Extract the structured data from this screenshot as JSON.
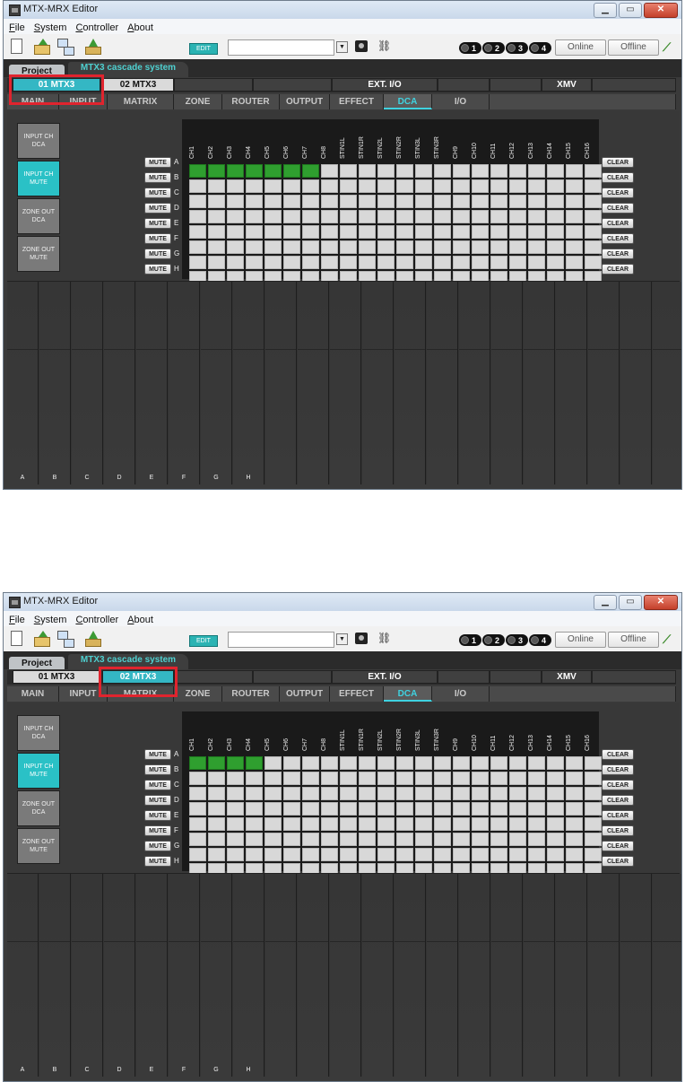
{
  "screenshots": [
    {
      "window": {
        "title": "MTX-MRX Editor",
        "buttons": [
          "▁",
          "▭",
          "✕"
        ]
      },
      "menu": [
        "File",
        "System",
        "Controller",
        "About"
      ],
      "menu_mnemonic": [
        "F",
        "S",
        "C",
        "A"
      ],
      "toolbar": {
        "edit_label": "EDIT",
        "signal_buttons": [
          "1",
          "2",
          "3",
          "4"
        ],
        "online_label": "Online",
        "offline_label": "Offline"
      },
      "tabs": {
        "project": "Project",
        "system": "MTX3 cascade system"
      },
      "units": [
        "01 MTX3",
        "02 MTX3",
        "",
        "",
        "EXT. I/O",
        "",
        "",
        "XMV",
        ""
      ],
      "selected_unit": 0,
      "function_tabs": [
        "MAIN",
        "INPUT",
        "MATRIX",
        "ZONE",
        "ROUTER",
        "OUTPUT",
        "EFFECT",
        "DCA",
        "I/O"
      ],
      "selected_function_tab": 7,
      "side_buttons": [
        "INPUT CH\nDCA",
        "INPUT CH\nMUTE",
        "ZONE OUT\nDCA",
        "ZONE OUT\nMUTE"
      ],
      "active_side_button": 1,
      "channels": [
        "CH1",
        "CH2",
        "CH3",
        "CH4",
        "CH5",
        "CH6",
        "CH7",
        "CH8",
        "STIN1L",
        "STIN1R",
        "STIN2L",
        "STIN2R",
        "STIN3L",
        "STIN3R",
        "CH9",
        "CH10",
        "CH11",
        "CH12",
        "CH13",
        "CH14",
        "CH15",
        "CH16"
      ],
      "rows": [
        "A",
        "B",
        "C",
        "D",
        "E",
        "F",
        "G",
        "H"
      ],
      "mute_label": "MUTE",
      "clear_label": "CLEAR",
      "active_row_a_channels": 7,
      "strip_labels": [
        "A",
        "B",
        "C",
        "D",
        "E",
        "F",
        "G",
        "H",
        "",
        "",
        "",
        "",
        "",
        "",
        "",
        "",
        "",
        "",
        "",
        "",
        ""
      ]
    },
    {
      "window": {
        "title": "MTX-MRX Editor",
        "buttons": [
          "▁",
          "▭",
          "✕"
        ]
      },
      "menu": [
        "File",
        "System",
        "Controller",
        "About"
      ],
      "menu_mnemonic": [
        "F",
        "S",
        "C",
        "A"
      ],
      "toolbar": {
        "edit_label": "EDIT",
        "signal_buttons": [
          "1",
          "2",
          "3",
          "4"
        ],
        "online_label": "Online",
        "offline_label": "Offline"
      },
      "tabs": {
        "project": "Project",
        "system": "MTX3 cascade system"
      },
      "units": [
        "01 MTX3",
        "02 MTX3",
        "",
        "",
        "EXT. I/O",
        "",
        "",
        "XMV",
        ""
      ],
      "selected_unit": 1,
      "function_tabs": [
        "MAIN",
        "INPUT",
        "MATRIX",
        "ZONE",
        "ROUTER",
        "OUTPUT",
        "EFFECT",
        "DCA",
        "I/O"
      ],
      "selected_function_tab": 7,
      "side_buttons": [
        "INPUT CH\nDCA",
        "INPUT CH\nMUTE",
        "ZONE OUT\nDCA",
        "ZONE OUT\nMUTE"
      ],
      "active_side_button": 1,
      "channels": [
        "CH1",
        "CH2",
        "CH3",
        "CH4",
        "CH5",
        "CH6",
        "CH7",
        "CH8",
        "STIN1L",
        "STIN1R",
        "STIN2L",
        "STIN2R",
        "STIN3L",
        "STIN3R",
        "CH9",
        "CH10",
        "CH11",
        "CH12",
        "CH13",
        "CH14",
        "CH15",
        "CH16"
      ],
      "rows": [
        "A",
        "B",
        "C",
        "D",
        "E",
        "F",
        "G",
        "H"
      ],
      "mute_label": "MUTE",
      "clear_label": "CLEAR",
      "active_row_a_channels": 4,
      "strip_labels": [
        "A",
        "B",
        "C",
        "D",
        "E",
        "F",
        "G",
        "H",
        "",
        "",
        "",
        "",
        "",
        "",
        "",
        "",
        "",
        "",
        "",
        "",
        ""
      ]
    }
  ],
  "colors": {
    "accent": "#34b7c4",
    "active_cell": "#2f9f2f",
    "highlight": "#e0242e"
  }
}
